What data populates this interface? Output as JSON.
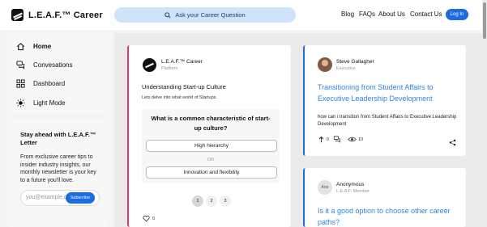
{
  "brand": {
    "name": "L.E.A.F.™ Career"
  },
  "search": {
    "placeholder": "Ask your Career Question"
  },
  "nav": {
    "links": [
      "Blog",
      "FAQs",
      "About Us",
      "Contact Us"
    ],
    "login_label": "Log In"
  },
  "sidebar": {
    "items": [
      {
        "label": "Home",
        "icon": "home-icon",
        "active": true
      },
      {
        "label": "Convesations",
        "icon": "chat-icon",
        "active": false
      },
      {
        "label": "Dashboard",
        "icon": "dashboard-icon",
        "active": false
      },
      {
        "label": "Light Mode",
        "icon": "sun-icon",
        "active": false
      }
    ]
  },
  "newsletter": {
    "title": "Stay ahead with L.E.A.F.™ Letter",
    "body": "From exclusive career tips to insider industry insights, our monthly newsletter is your key to a future you'll love.",
    "email_placeholder": "you@example.c",
    "subscribe_label": "Subscribe"
  },
  "feed": {
    "poll_post": {
      "author": "L.E.A.F.™ Career",
      "author_role": "Platform",
      "title": "Understanding Start-up Culture",
      "subtitle": "Lets delve into what world of Startups.",
      "question": "What is a common characteristic of start-up culture?",
      "options": [
        "High hierarchy",
        "Innovation and flexibility"
      ],
      "separator": "OR",
      "pages": [
        "1",
        "2",
        "3"
      ],
      "active_page": "1",
      "likes": "0",
      "accent": "#e8336b"
    },
    "question_post": {
      "author": "Steve Gallagher",
      "author_role": "Executive",
      "title": "Transitioning from Student Affairs to Executive Leadership Development",
      "body": "how can i transition from Student Affairs to Executive Leadership Development",
      "upvotes": "0",
      "views": "10",
      "accent": "#1a6ce0"
    },
    "anon_post": {
      "author": "Anonymous",
      "author_role": "L.E.A.F. Member",
      "avatar_text": "Ano",
      "title": "Is it a good option to choose other career paths?"
    }
  },
  "colors": {
    "primary": "#1a6ce0",
    "link": "#2e86de",
    "search_bg": "#cfe3fb"
  }
}
